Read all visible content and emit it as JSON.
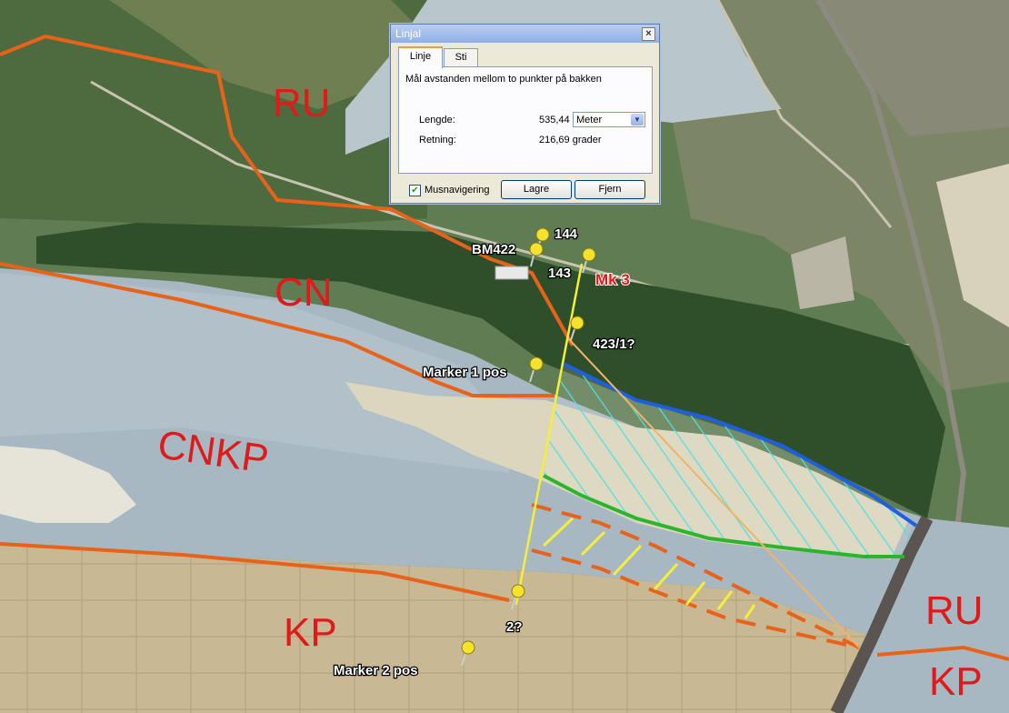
{
  "map_labels": {
    "ru_top": "RU",
    "cn": "CN",
    "cnkp": "CNKP",
    "kp_left": "KP",
    "ru_right": "RU",
    "kp_right": "KP"
  },
  "placemarks": {
    "p144": "144",
    "bm422": "BM422",
    "p143": "143",
    "mk3": "Mk 3",
    "p423": "423/1?",
    "marker1": "Marker 1 pos",
    "p2": "2?",
    "marker2": "Marker 2 pos"
  },
  "dialog": {
    "title": "Linjal",
    "tabs": [
      "Linje",
      "Sti"
    ],
    "description": "Mål avstanden mellom to punkter på bakken",
    "length_label": "Lengde:",
    "length_value": "535,44",
    "unit_selected": "Meter",
    "heading_label": "Retning:",
    "heading_value": "216,69 grader",
    "mouse_nav_label": "Musnavigering",
    "mouse_nav_checked": true,
    "save_label": "Lagre",
    "remove_label": "Fjern"
  },
  "colors": {
    "border_line": "#e8621a",
    "river_edge": "#1d5fe0",
    "sand_edge": "#2bb52b",
    "hatch": "#4fe0e0",
    "ruler": "#f4f03a",
    "label": "#e01a1a"
  }
}
